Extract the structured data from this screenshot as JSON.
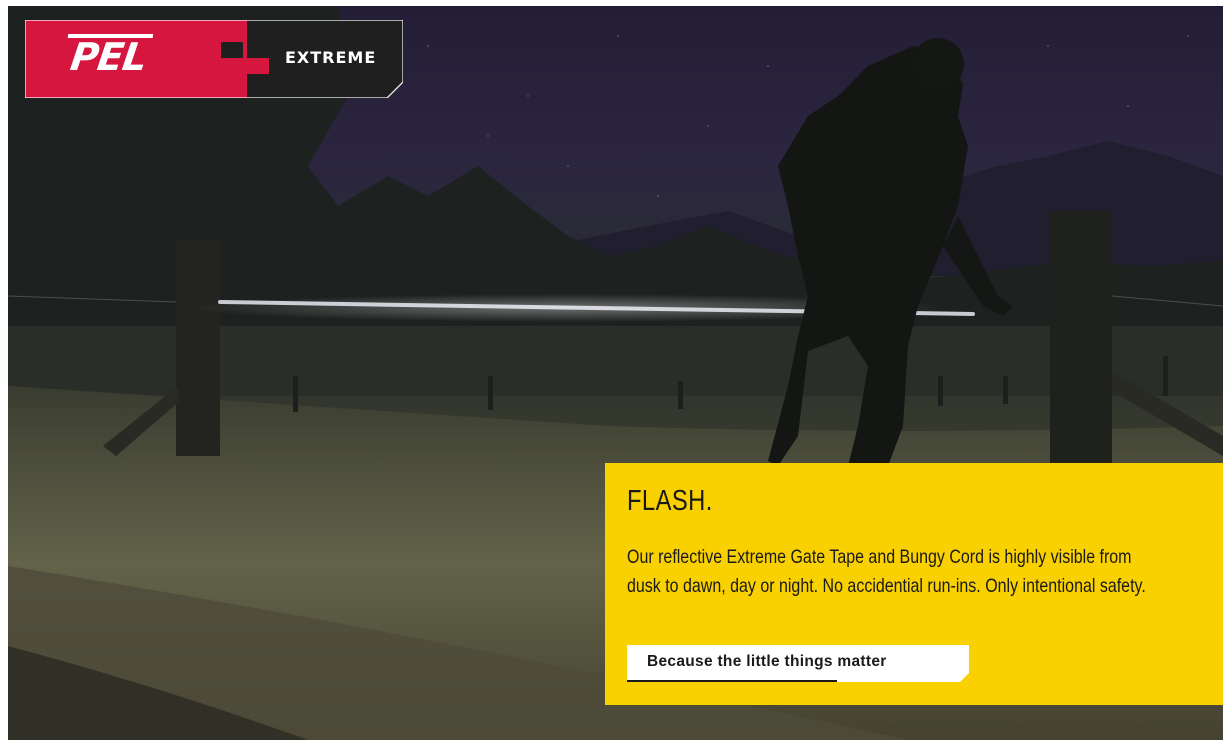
{
  "brand": {
    "logo_text": "PEL",
    "tagline": "EXTREME",
    "colors": {
      "red": "#d5173f",
      "dark": "#1f1f1f",
      "accent_yellow": "#f9d000"
    }
  },
  "hero": {
    "background": "night-farm-gate-photo"
  },
  "promo": {
    "title": "FLASH.",
    "body": "Our reflective Extreme Gate Tape and Bungy Cord is highly visible from dusk to dawn, day or night. No accidential run-ins. Only intentional safety.",
    "cta_label": "Because the little things matter"
  }
}
